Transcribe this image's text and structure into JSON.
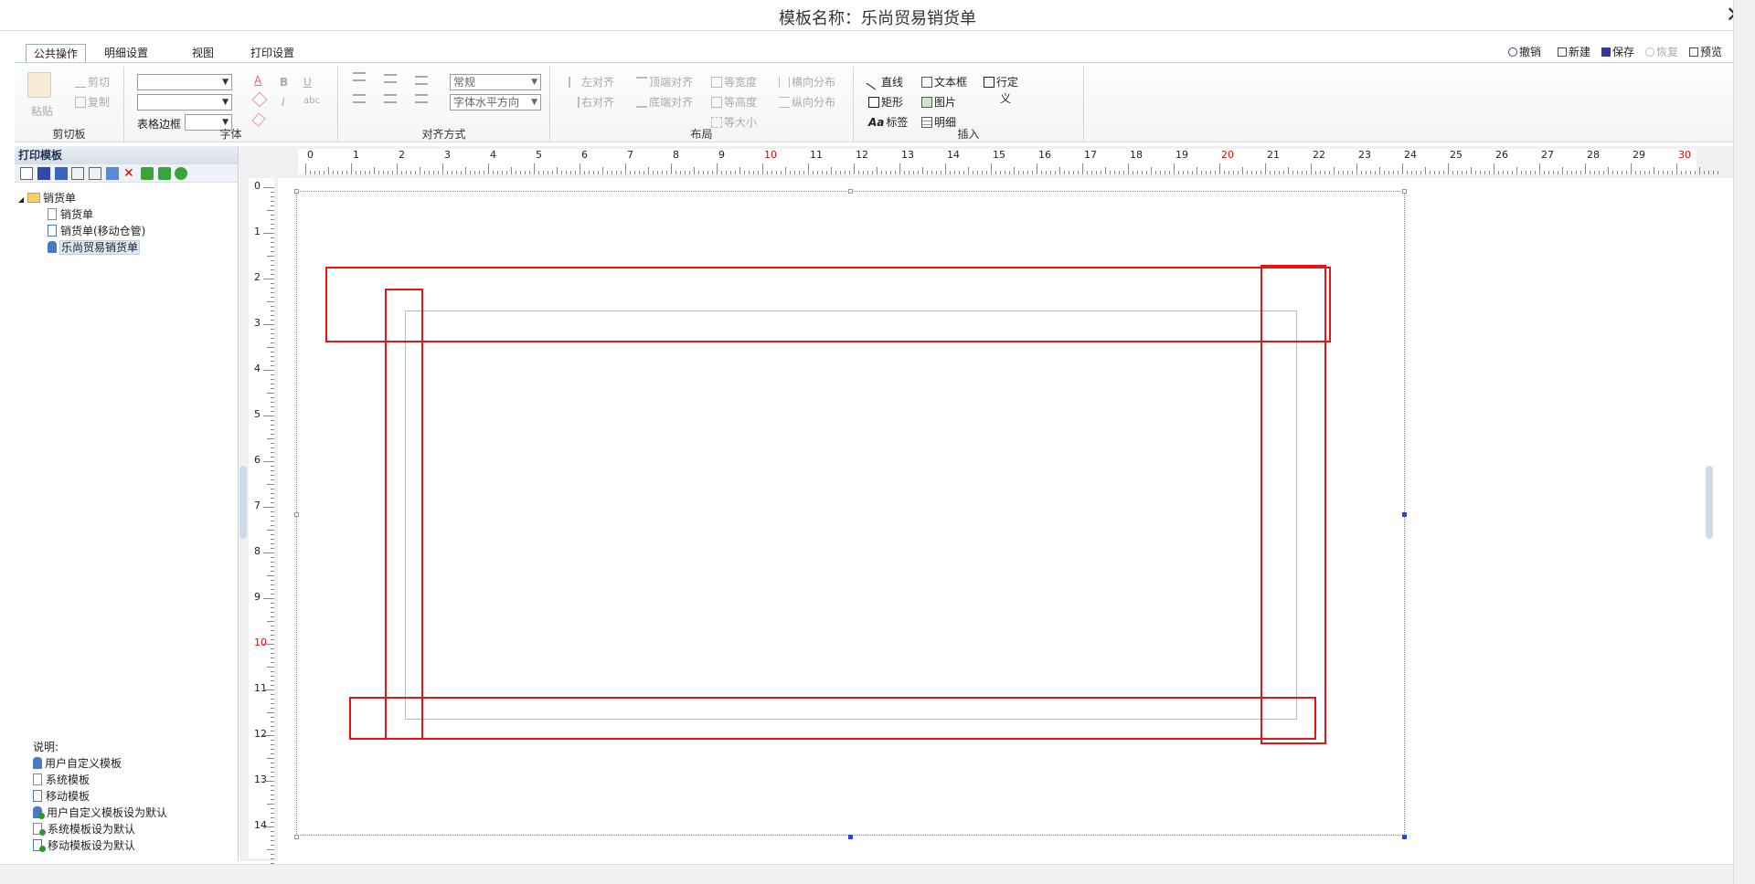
{
  "window": {
    "title": "模板名称：乐尚贸易销货单",
    "close": "✕"
  },
  "tabs": [
    "公共操作",
    "明细设置",
    "视图",
    "打印设置"
  ],
  "actions": {
    "undo": "撤销",
    "new": "新建",
    "save": "保存",
    "redo": "恢复",
    "preview": "预览"
  },
  "clipboard": {
    "paste": "粘贴",
    "cut": "剪切",
    "copy": "复制",
    "label": "剪切板"
  },
  "font": {
    "table_border": "表格边框",
    "label": "字体",
    "bold": "B",
    "italic": "I",
    "underline": "U",
    "size_style": "常规",
    "h_align": "字体水平方向"
  },
  "align": {
    "label": "对齐方式"
  },
  "layout": {
    "label": "布局",
    "left": "左对齐",
    "right": "右对齐",
    "top": "顶端对齐",
    "bottom": "底端对齐",
    "same_width": "等宽度",
    "same_height": "等高度",
    "same_size": "等大小",
    "h_dist": "横向分布",
    "v_dist": "纵向分布"
  },
  "insert": {
    "label": "插入",
    "line": "直线",
    "rect": "矩形",
    "label_item": "标签",
    "textbox": "文本框",
    "image": "图片",
    "detail": "明细",
    "custom": "行定",
    "custom2": "义",
    "label_icon": "Aa"
  },
  "left_panel": {
    "header": "打印模板",
    "tree": {
      "root": "销货单",
      "children": [
        "销货单",
        "销货单(移动仓管)",
        "乐尚贸易销货单"
      ]
    },
    "legend_title": "说明:",
    "legend": [
      "用户自定义模板",
      "系统模板",
      "移动模板",
      "用户自定义模板设为默认",
      "系统模板设为默认",
      "移动模板设为默认"
    ]
  },
  "ruler": {
    "h": [
      "0",
      "1",
      "2",
      "3",
      "4",
      "5",
      "6",
      "7",
      "8",
      "9",
      "10",
      "11",
      "12",
      "13",
      "14",
      "15",
      "16",
      "17",
      "18",
      "19",
      "20",
      "21",
      "22",
      "23",
      "24",
      "25",
      "26",
      "27",
      "28",
      "29",
      "30"
    ],
    "v": [
      "0",
      "1",
      "2",
      "3",
      "4",
      "5",
      "6",
      "7",
      "8",
      "9",
      "10",
      "11",
      "12",
      "13",
      "14"
    ],
    "red_marks": [
      "10",
      "20",
      "30"
    ]
  },
  "colors": {
    "accent": "#2b44d8",
    "highlight": "#e11111",
    "ruler_red": "#ee0000"
  }
}
